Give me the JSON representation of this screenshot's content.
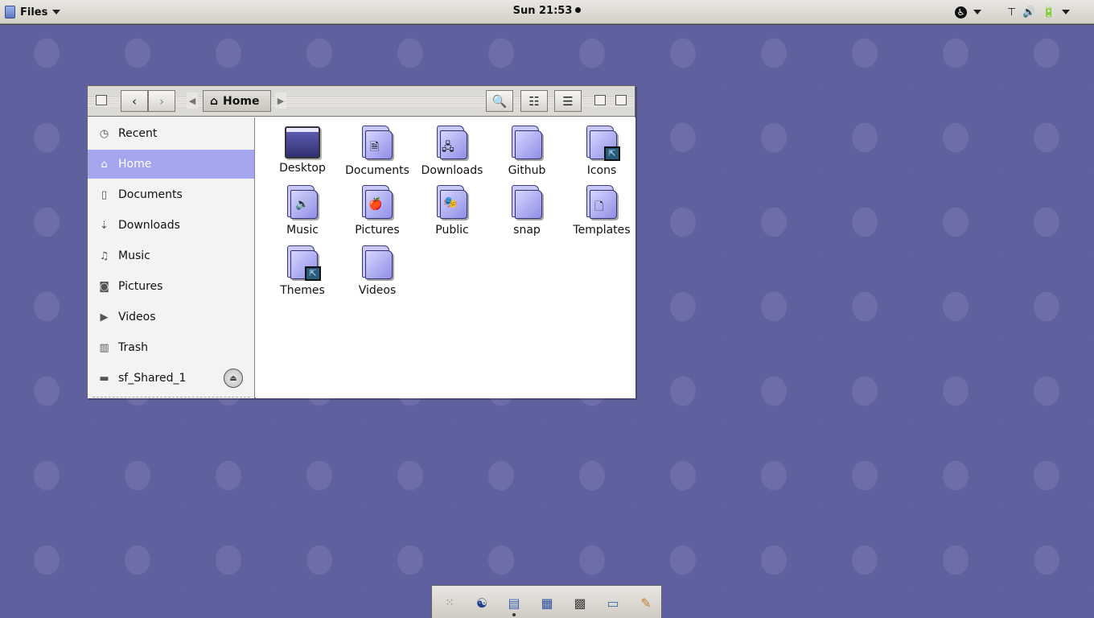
{
  "topbar": {
    "app_name": "Files",
    "clock": "Sun 21:53"
  },
  "window": {
    "location": "Home"
  },
  "sidebar": {
    "items": [
      {
        "label": "Recent",
        "icon": "clock-icon"
      },
      {
        "label": "Home",
        "icon": "home-icon",
        "active": true
      },
      {
        "label": "Documents",
        "icon": "document-icon"
      },
      {
        "label": "Downloads",
        "icon": "download-icon"
      },
      {
        "label": "Music",
        "icon": "music-icon"
      },
      {
        "label": "Pictures",
        "icon": "camera-icon"
      },
      {
        "label": "Videos",
        "icon": "video-icon"
      },
      {
        "label": "Trash",
        "icon": "trash-icon"
      },
      {
        "label": "sf_Shared_1",
        "icon": "drive-icon"
      }
    ]
  },
  "files": [
    {
      "label": "Desktop",
      "icon": "desktop-folder-icon"
    },
    {
      "label": "Documents",
      "icon": "documents-folder-icon"
    },
    {
      "label": "Downloads",
      "icon": "downloads-folder-icon"
    },
    {
      "label": "Github",
      "icon": "folder-icon"
    },
    {
      "label": "Icons",
      "icon": "alias-folder-icon"
    },
    {
      "label": "Music",
      "icon": "music-folder-icon"
    },
    {
      "label": "Pictures",
      "icon": "pictures-folder-icon"
    },
    {
      "label": "Public",
      "icon": "public-folder-icon"
    },
    {
      "label": "snap",
      "icon": "folder-icon"
    },
    {
      "label": "Templates",
      "icon": "templates-folder-icon"
    },
    {
      "label": "Themes",
      "icon": "alias-folder-icon"
    },
    {
      "label": "Videos",
      "icon": "folder-icon"
    }
  ],
  "colors": {
    "desktop": "#5f619f",
    "sidebar_active": "#a6a5f0",
    "folder": "#b7b6f2"
  }
}
